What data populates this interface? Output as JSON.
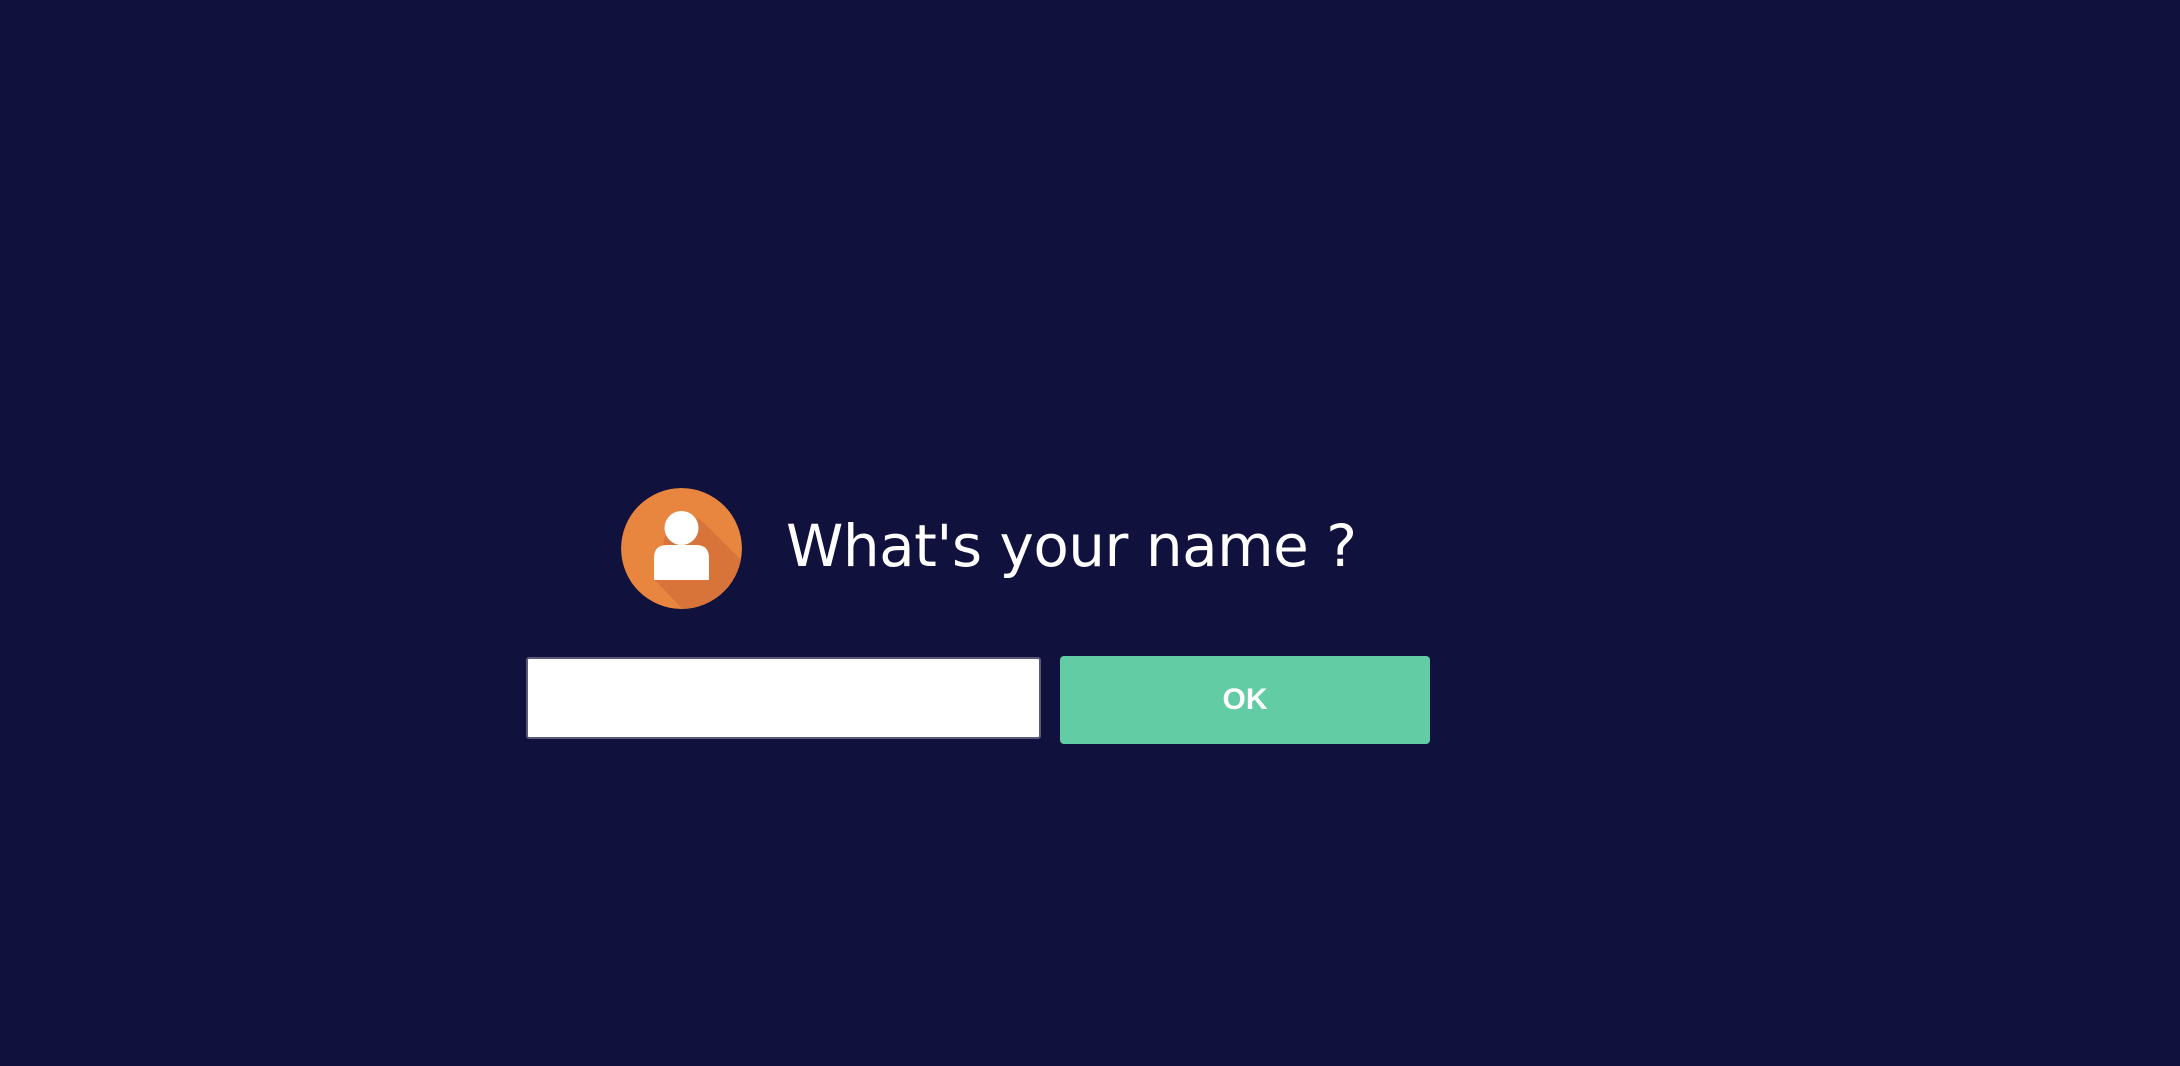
{
  "prompt": {
    "title": "What's your name ?",
    "avatar_icon": "user-avatar-icon"
  },
  "name_input": {
    "value": "",
    "placeholder": ""
  },
  "ok_button": {
    "label": "OK"
  },
  "colors": {
    "background": "#11113d",
    "avatar_circle": "#e8853f",
    "avatar_shadow": "#d8743a",
    "ok_button": "#62cca5",
    "title_text": "#ffffff"
  }
}
